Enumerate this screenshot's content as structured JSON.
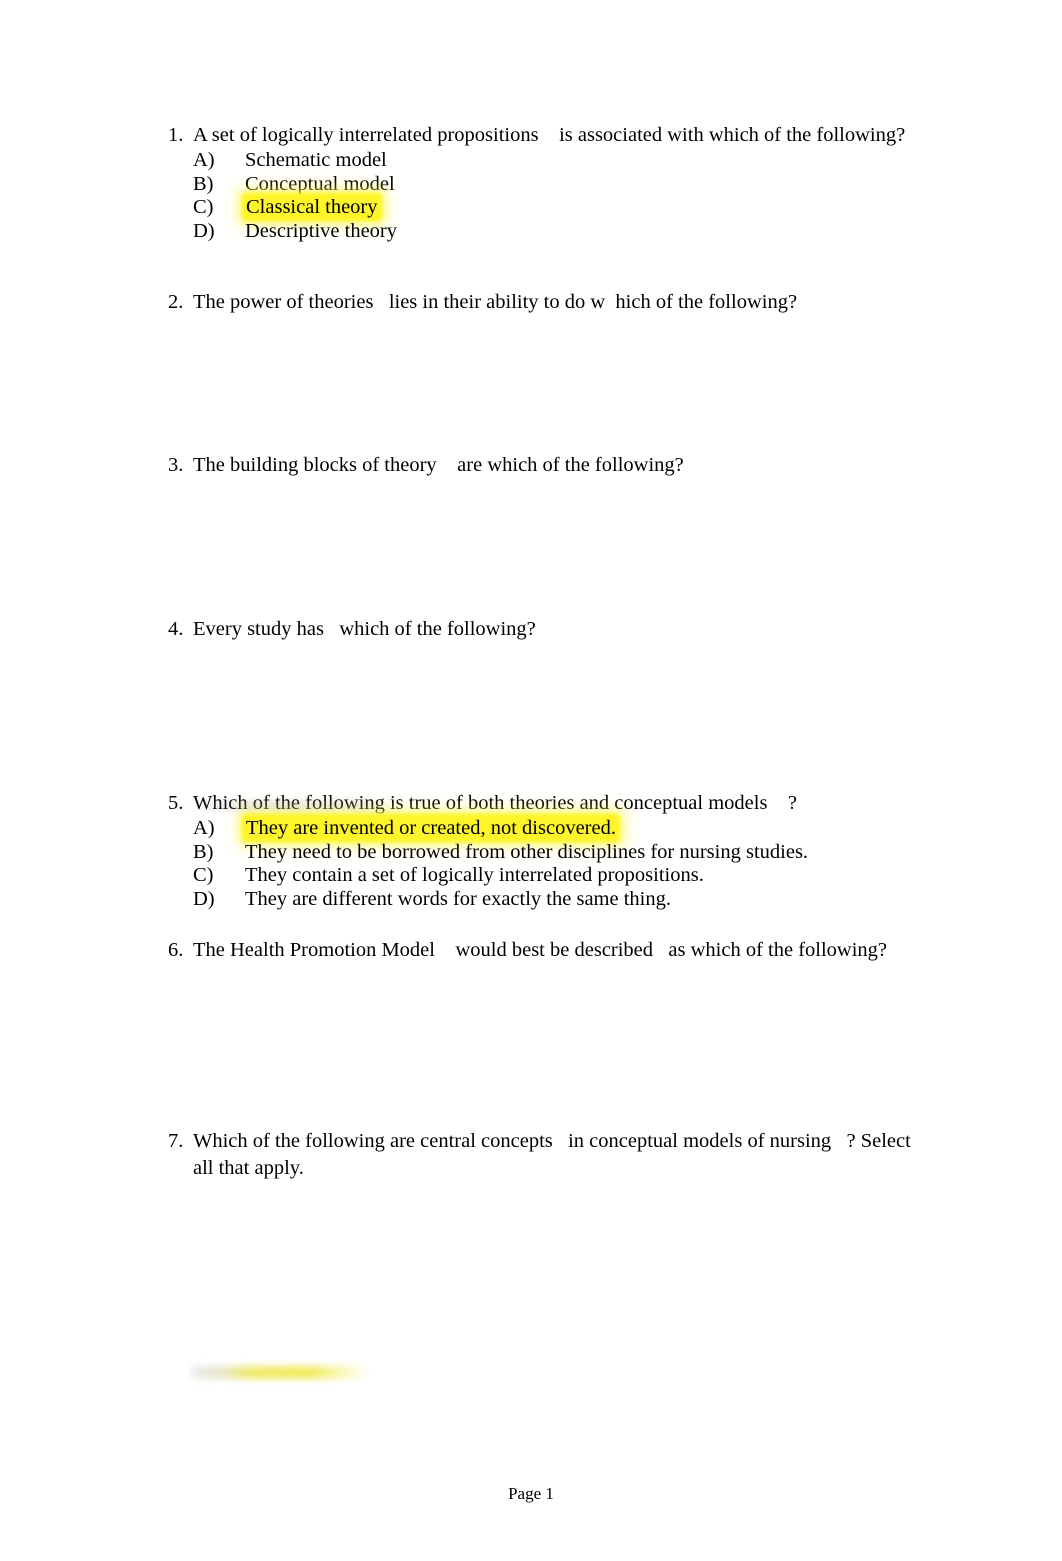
{
  "document": {
    "footer_label": "Page 1"
  },
  "questions": [
    {
      "number": "1.",
      "text": "A set of logically interrelated propositions    is associated with which of the following?",
      "options": [
        {
          "letter": "A)",
          "text": "Schematic model",
          "highlighted": false
        },
        {
          "letter": "B)",
          "text": "Conceptual model",
          "highlighted": false
        },
        {
          "letter": "C)",
          "text": "Classical theory",
          "highlighted": true
        },
        {
          "letter": "D)",
          "text": "Descriptive theory",
          "highlighted": false
        }
      ]
    },
    {
      "number": "2.",
      "text": "The power of theories   lies in their ability to do w  hich of the following?",
      "options": []
    },
    {
      "number": "3.",
      "text": "The building blocks of theory    are which of the following?",
      "options": []
    },
    {
      "number": "4.",
      "text": "Every study has   which of the following?",
      "options": []
    },
    {
      "number": "5.",
      "text": "Which of the following is true of both theories and conceptual models    ?",
      "options": [
        {
          "letter": "A)",
          "text": "They are invented or created, not discovered.",
          "highlighted": true
        },
        {
          "letter": "B)",
          "text": "They need to be borrowed from other disciplines for nursing studies.",
          "highlighted": false
        },
        {
          "letter": "C)",
          "text": "They contain a set of logically interrelated propositions.",
          "highlighted": false
        },
        {
          "letter": "D)",
          "text": "They are different words for exactly the same thing.",
          "highlighted": false
        }
      ]
    },
    {
      "number": "6.",
      "text": "The Health Promotion Model    would best be described   as which of the following?",
      "options": []
    },
    {
      "number": "7.",
      "text": "Which of the following are central concepts   in conceptual models of nursing   ? Select all that apply.",
      "options": []
    }
  ],
  "artifacts": {
    "highlight_color": "#fdf529",
    "faded_highlight_upper": "gray-smudge-remnant",
    "faded_highlight_lower": "yellow-highlight-remnant"
  }
}
